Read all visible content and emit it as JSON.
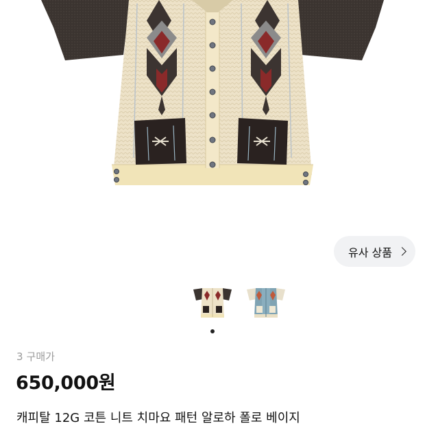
{
  "product_image": {
    "icon": "knit-polo-shirt-image",
    "colors": {
      "body": "#ede0c4",
      "sleeve": "#3a332f",
      "pocket": "#2a2220",
      "pattern_red": "#8a2a2a",
      "pattern_grey": "#8d8d8d"
    }
  },
  "similar_button": {
    "label": "유사 상품"
  },
  "thumbnails": [
    {
      "icon": "beige-polo-thumbnail",
      "variant": "beige"
    },
    {
      "icon": "blue-polo-thumbnail",
      "variant": "blue"
    }
  ],
  "carousel": {
    "active_index": 0,
    "total": 1
  },
  "stats": {
    "buyer_count": "3",
    "buyer_label": "구매가"
  },
  "price": "650,000원",
  "title": "캐피탈 12G 코튼 니트 치마요 패턴 알로하 폴로 베이지"
}
